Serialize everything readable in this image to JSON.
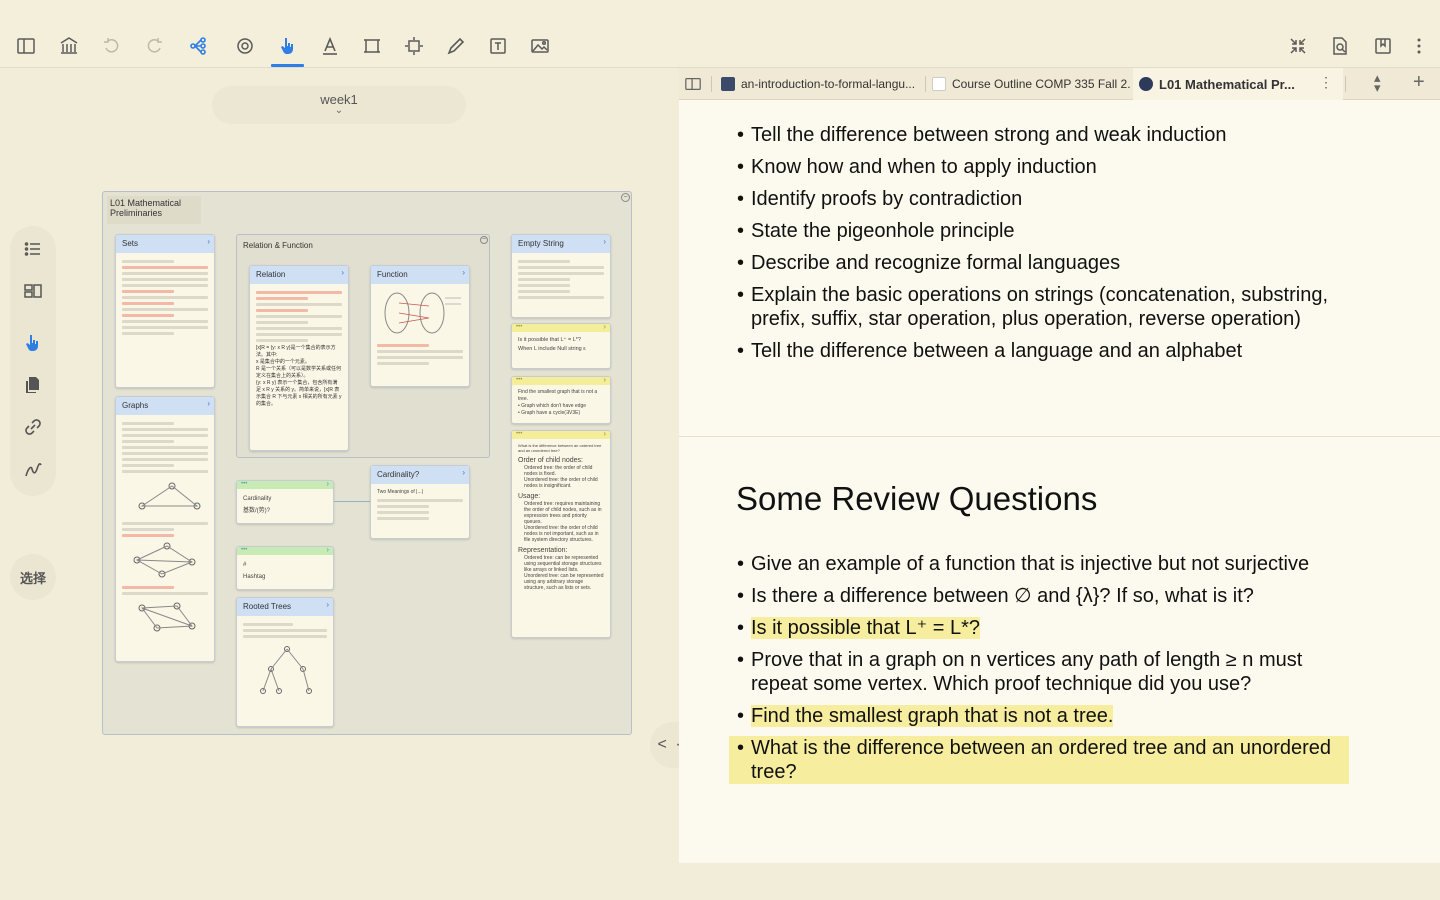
{
  "toolbar": {
    "left_icons": [
      "sidebar-toggle-icon",
      "library-icon",
      "undo-icon",
      "redo-icon",
      "mindmap-icon",
      "focus-icon",
      "hand-pointer-icon",
      "text-highlight-icon",
      "crop-icon",
      "frame-icon",
      "pen-icon",
      "textbox-icon",
      "image-icon"
    ],
    "right_icons": [
      "collapse-icon",
      "document-search-icon",
      "bookmark-icon",
      "more-icon"
    ],
    "accent": "#2f7ee6"
  },
  "canvas": {
    "week_label": "week1",
    "select_label": "选择",
    "board_title": "L01 Mathematical Preliminaries",
    "cards": {
      "sets": "Sets",
      "graphs": "Graphs",
      "relation_function": "Relation & Function",
      "relation": "Relation",
      "function": "Function",
      "empty_string": "Empty String",
      "cardinality": "Cardinality?",
      "cardinality_note": "Cardinality",
      "cardinality_note_zh": "基数/(势)?",
      "hashtag": "Hashtag",
      "rooted_trees": "Rooted Trees",
      "q_lplus": "Is it possible that L⁺ = L*?",
      "q_lplus_sub": "When L include Null string ε",
      "q_tree": "Find the smallest graph that is not a tree.",
      "q_tree_b1": "Graph which don't have edge",
      "q_tree_b2": "Graph have a cycle(∃V3E)",
      "q_ordered": "What is the difference between an ordered tree and an unordered tree?",
      "order_title": "Order of child nodes:",
      "order_b1": "Ordered tree: the order of child nodes is fixed.",
      "order_b2": "Unordered tree: the order of child nodes is insignificant.",
      "usage_title": "Usage:",
      "usage_b1": "Ordered tree: requires maintaining the order of child nodes, such as in expression trees and priority queues.",
      "usage_b2": "Unordered tree: the order of child nodes is not important, such as in file system directory structures.",
      "repr_title": "Representation:",
      "repr_b1": "Ordered tree: can be represented using sequential storage structures like arrays or linked lists.",
      "repr_b2": "Unordered tree: can be represented using any arbitrary storage structure, such as lists or sets.",
      "relation_zh_1": "[x]R = {y: x R y}是一个集合的表示方法。其中:",
      "relation_zh_2": "x 是集合中的一个元素。",
      "relation_zh_3": "R 是一个关系（可以是数学关系或任何定义在集合上的关系）。",
      "relation_zh_4": "{y: x R y} 表示一个集合，包含所有满足 x R y 关系的 y。简单来说，[x]R 表示集合 R 下与元素 x 相关的所有元素 y 的集合。",
      "cardinality_sub": "Two Meanings of |...|"
    }
  },
  "tabs": [
    {
      "label": "an-introduction-to-formal-langu...",
      "icon_color": "#3b4a6b",
      "active": false
    },
    {
      "label": "Course Outline COMP 335 Fall 2...",
      "icon_color": "#cccccc",
      "active": false
    },
    {
      "label": "L01 Mathematical Pr...",
      "icon_color": "#2e3a5c",
      "active": true
    }
  ],
  "document": {
    "objectives": [
      "Tell the difference between strong and weak induction",
      "Know how and when to apply induction",
      "Identify proofs by contradiction",
      "State the pigeonhole principle",
      "Describe and recognize formal languages",
      "Explain the basic operations on strings (concatenation, substring, prefix, suffix, star operation, plus operation, reverse operation)",
      "Tell the difference between a language and an alphabet"
    ],
    "section_title": "Some Review Questions",
    "questions": [
      "Give an example of a function that is injective but not surjective",
      "Is there a difference between ∅ and {λ}? If so, what is it?",
      "Is it possible that L⁺ = L*?",
      "Prove that in a graph on n vertices any path of length ≥ n must repeat some vertex. Which proof technique did you use?",
      "Find the smallest graph that is not a tree.",
      "What is the difference between an ordered tree and an unordered tree?"
    ],
    "highlight_color": "#f6ee9e"
  },
  "nav": {
    "label": "< · >"
  }
}
